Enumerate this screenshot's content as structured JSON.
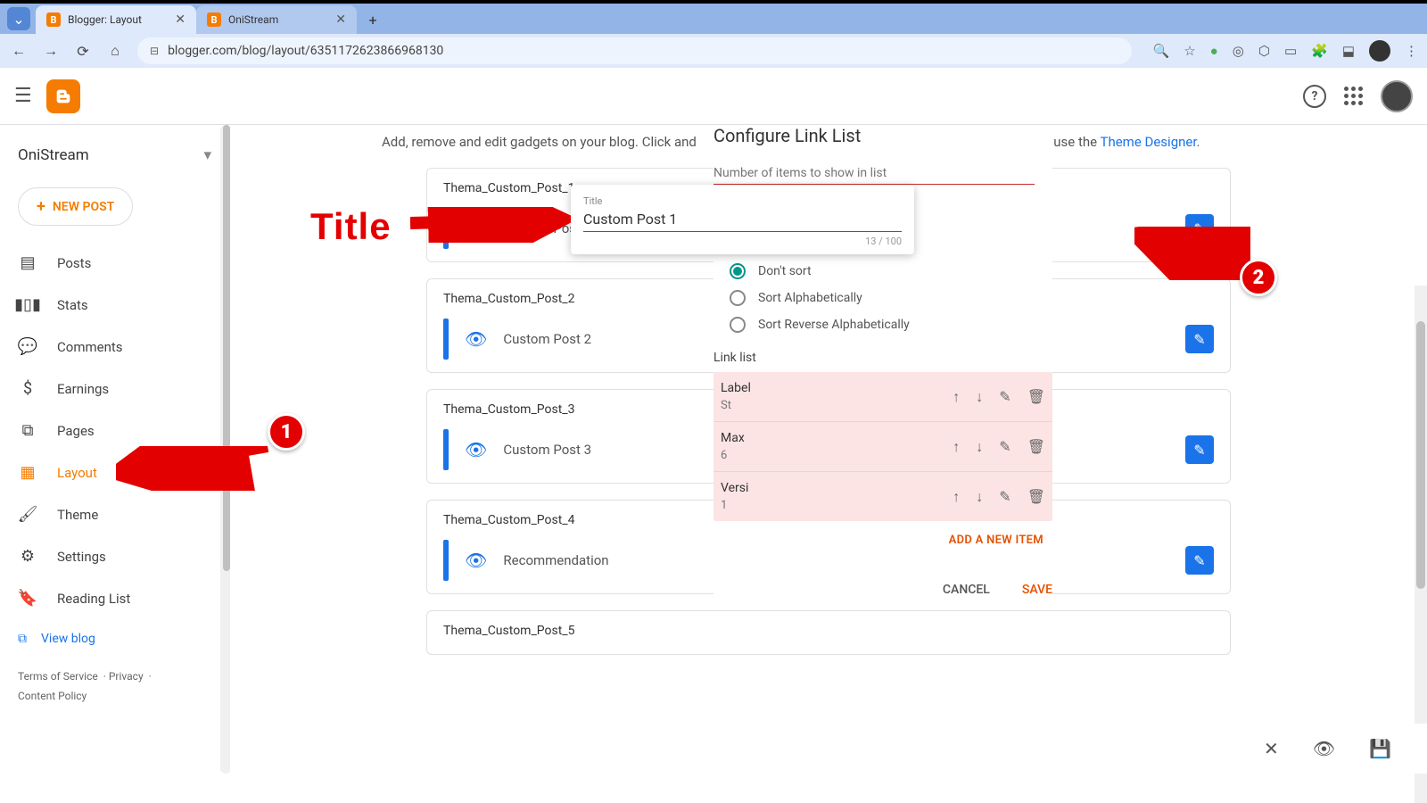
{
  "browser": {
    "tabs": [
      {
        "title": "Blogger: Layout",
        "active": true
      },
      {
        "title": "OniStream",
        "active": false
      }
    ],
    "url": "blogger.com/blog/layout/6351172623866968130"
  },
  "header": {},
  "sidebar": {
    "blog_name": "OniStream",
    "new_post": "NEW POST",
    "items": [
      {
        "icon": "posts",
        "label": "Posts"
      },
      {
        "icon": "stats",
        "label": "Stats"
      },
      {
        "icon": "comments",
        "label": "Comments"
      },
      {
        "icon": "earnings",
        "label": "Earnings"
      },
      {
        "icon": "pages",
        "label": "Pages"
      },
      {
        "icon": "layout",
        "label": "Layout",
        "active": true
      },
      {
        "icon": "theme",
        "label": "Theme"
      },
      {
        "icon": "settings",
        "label": "Settings"
      },
      {
        "icon": "reading",
        "label": "Reading List"
      }
    ],
    "view_blog": "View blog",
    "footer": {
      "terms": "Terms of Service",
      "privacy": "Privacy",
      "content": "Content Policy"
    }
  },
  "content": {
    "hint_prefix": "Add, remove and edit gadgets on your blog. Click and",
    "hint_suffix": ", use the ",
    "hint_link": "Theme Designer",
    "sections": [
      {
        "title": "Thema_Custom_Post_1",
        "name": "Custom Post 1"
      },
      {
        "title": "Thema_Custom_Post_2",
        "name": "Custom Post 2"
      },
      {
        "title": "Thema_Custom_Post_3",
        "name": "Custom Post 3"
      },
      {
        "title": "Thema_Custom_Post_4",
        "name": "Recommendation"
      },
      {
        "title": "Thema_Custom_Post_5",
        "name": ""
      }
    ]
  },
  "config": {
    "title": "Configure Link List",
    "items_label": "Number of items to show in list",
    "sort_options": [
      "Don't sort",
      "Sort Alphabetically",
      "Sort Reverse Alphabetically"
    ],
    "sort_selected": 0,
    "link_list_label": "Link list",
    "links": [
      {
        "label": "Label",
        "value": "St"
      },
      {
        "label": "Max",
        "value": "6"
      },
      {
        "label": "Versi",
        "value": "1"
      }
    ],
    "add_item": "ADD A NEW ITEM",
    "cancel": "CANCEL",
    "save": "SAVE"
  },
  "tooltip": {
    "label": "Title",
    "value": "Custom Post 1",
    "counter": "13 / 100"
  },
  "annotations": {
    "title": "Title",
    "badge1": "1",
    "badge2": "2"
  }
}
